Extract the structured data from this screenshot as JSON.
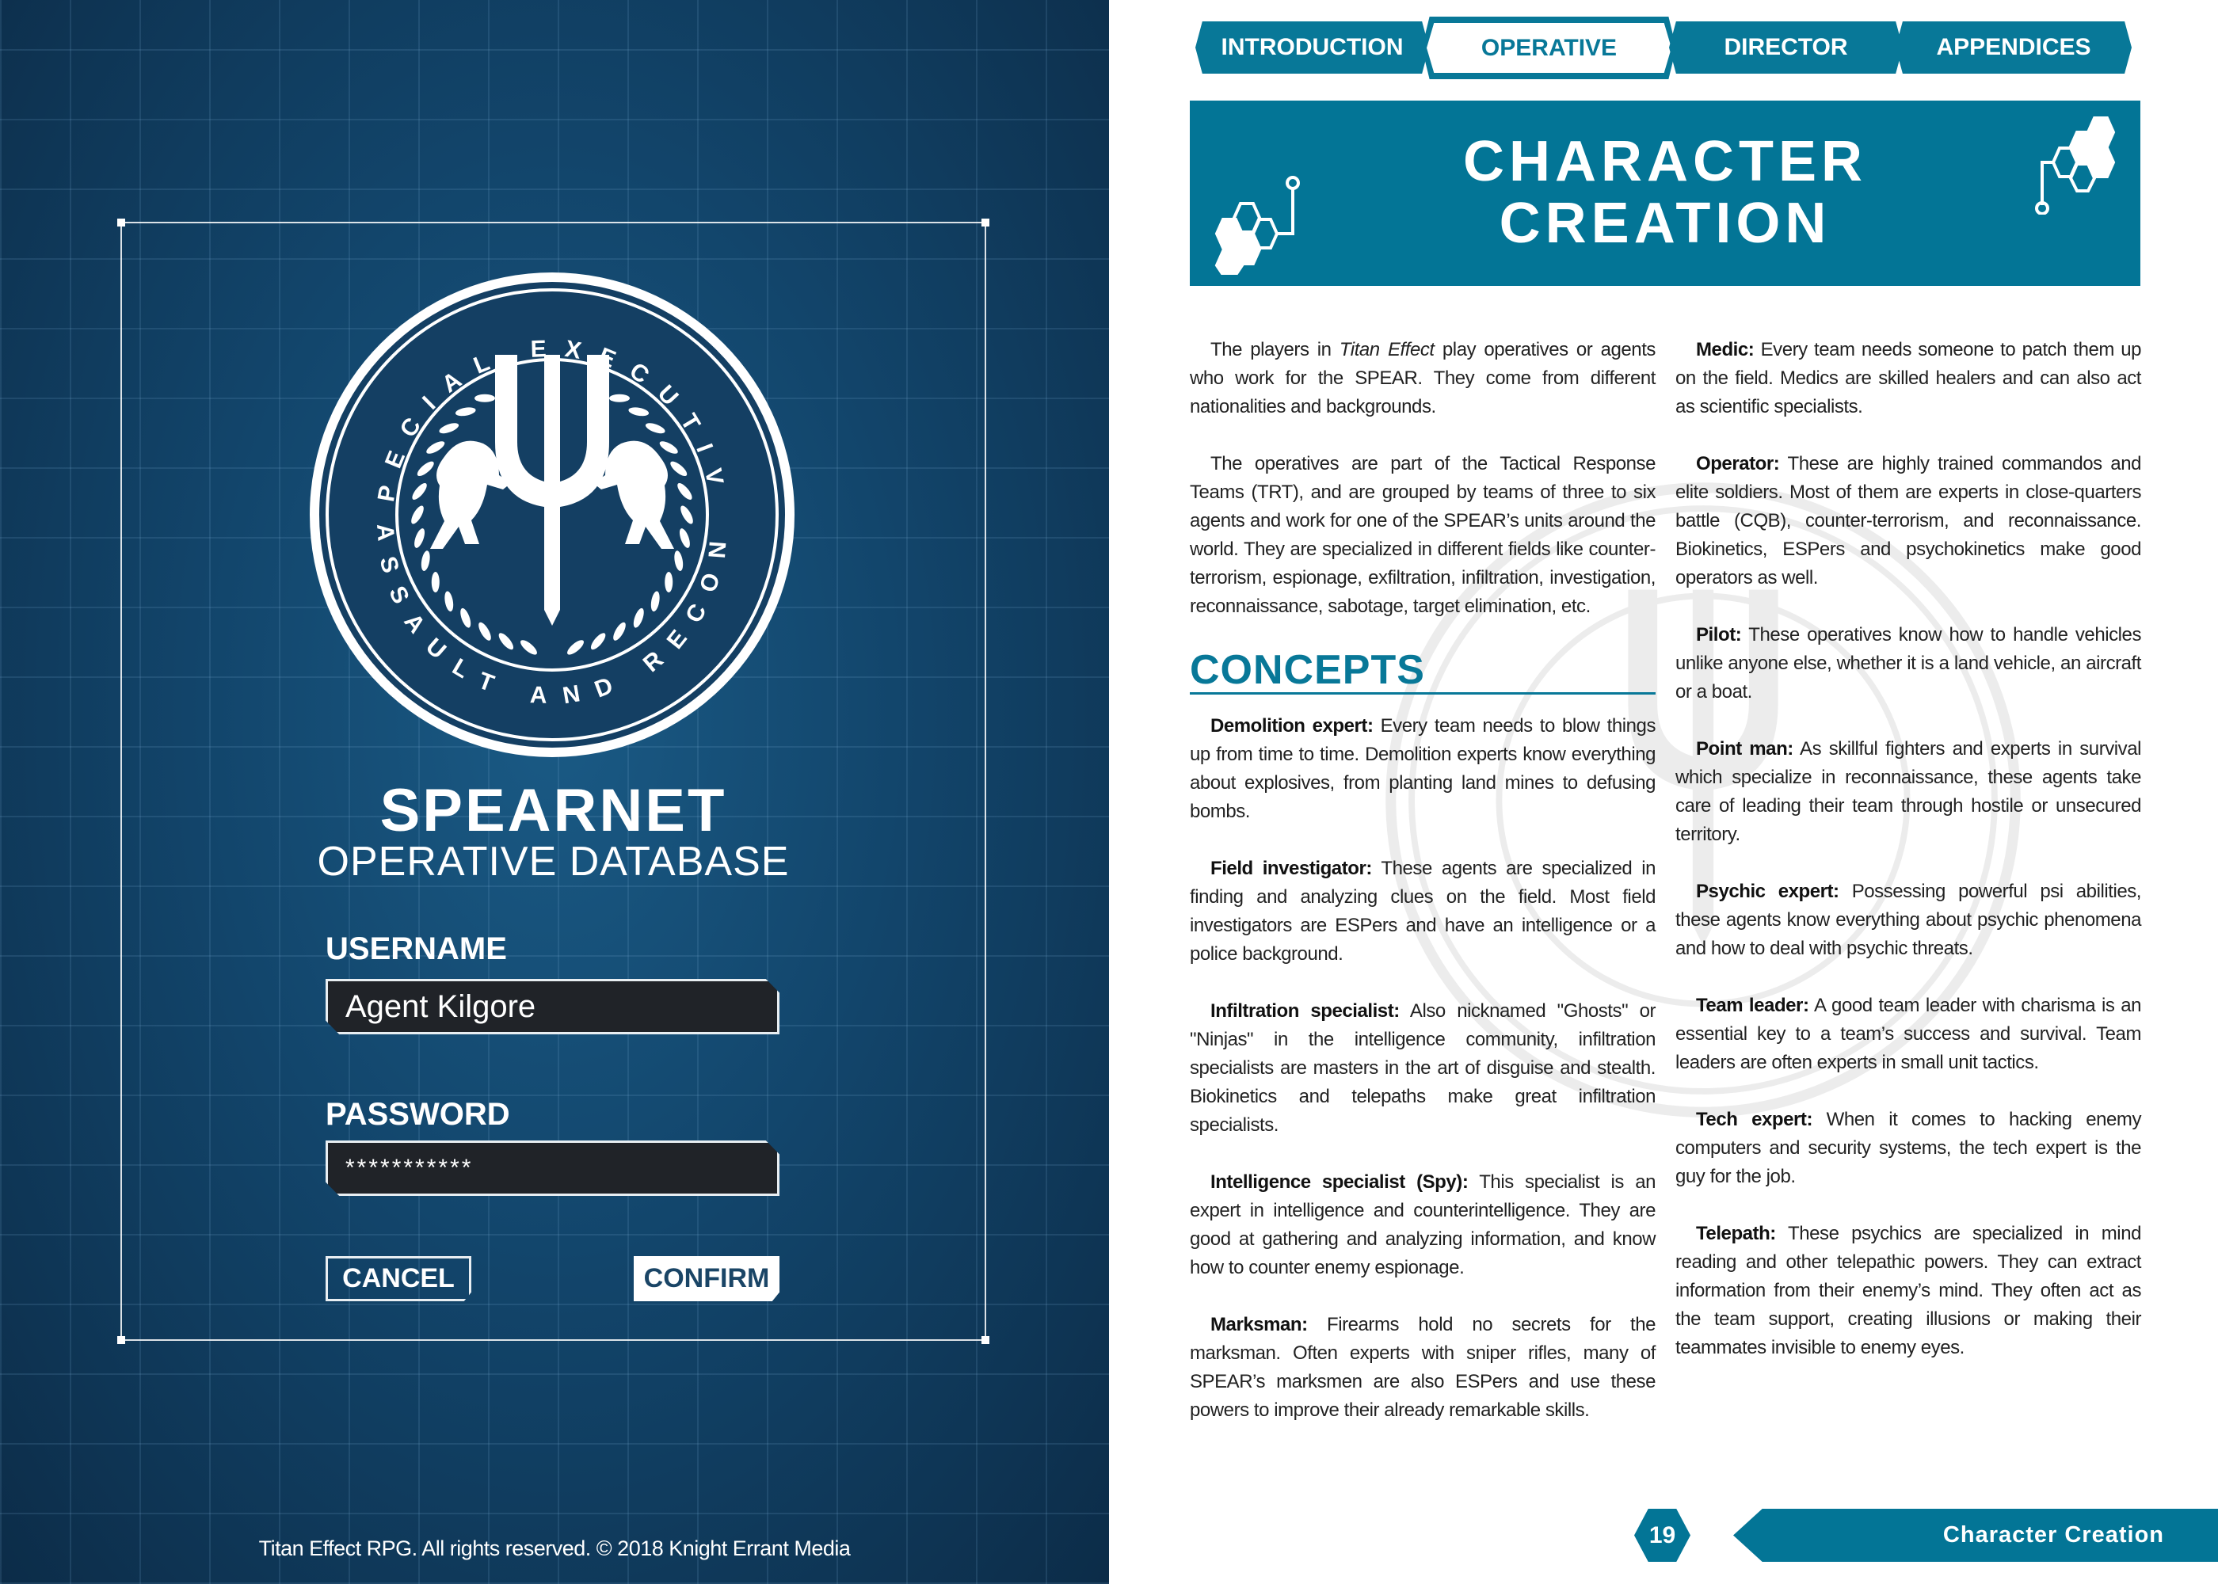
{
  "login": {
    "emblem_top_text": "SPECIAL EXECUTIVE",
    "emblem_bottom_text": "ASSAULT AND RECON",
    "title": "SPEARNET",
    "subtitle": "OPERATIVE DATABASE",
    "username_label": "USERNAME",
    "username_value": "Agent Kilgore",
    "password_label": "PASSWORD",
    "password_value": "***********",
    "cancel_label": "CANCEL",
    "confirm_label": "CONFIRM",
    "copyright": "Titan Effect RPG. All rights reserved. © 2018 Knight Errant Media"
  },
  "nav": {
    "tabs": [
      {
        "label": "INTRODUCTION",
        "active": false
      },
      {
        "label": "OPERATIVE",
        "active": true
      },
      {
        "label": "DIRECTOR",
        "active": false
      },
      {
        "label": "APPENDICES",
        "active": false
      }
    ]
  },
  "banner": {
    "title_line1": "CHARACTER",
    "title_line2": "CREATION"
  },
  "intro": {
    "p1_before": "The players in ",
    "p1_italic": "Titan Effect",
    "p1_after": " play operatives or agents who work for the SPEAR. They come from different nationalities and backgrounds.",
    "p2": "The operatives are part of the Tactical Response Teams (TRT), and are grouped by teams of three to six agents and work for one of the SPEAR’s units around the world. They are specialized in different fields like counter-terrorism, espionage, exfiltration, infiltration, investigation, reconnaissance, sabotage, target elimination, etc."
  },
  "concepts_heading": "CONCEPTS",
  "concepts_left": [
    {
      "term": "Demolition expert:",
      "text": " Every team needs to blow things up from time to time. Demolition experts know everything about explosives, from planting land mines to defusing bombs."
    },
    {
      "term": "Field investigator:",
      "text": " These agents are specialized in finding and analyzing clues on the field. Most field investigators are ESPers and have an intelligence or a police background."
    },
    {
      "term": "Infiltration specialist:",
      "text": " Also nicknamed \"Ghosts\" or \"Ninjas\" in the intelligence community, infiltration specialists are masters in the art of disguise and stealth. Biokinetics and telepaths make great infiltration specialists."
    },
    {
      "term": "Intelligence specialist (Spy):",
      "text": " This specialist is an expert in intelligence and counterintelligence. They are good at gathering and analyzing information, and know how to counter enemy espionage."
    },
    {
      "term": "Marksman:",
      "text": " Firearms hold no secrets for the marksman. Often experts with sniper rifles, many of SPEAR’s marksmen are also ESPers and use these powers to improve their already remarkable skills."
    }
  ],
  "concepts_right": [
    {
      "term": "Medic:",
      "text": " Every team needs someone to patch them up on the field. Medics are skilled healers and can also act as scientific specialists."
    },
    {
      "term": "Operator:",
      "text": " These are highly trained commandos and elite soldiers. Most of them are experts in close-quarters battle (CQB), counter-terrorism, and reconnaissance. Biokinetics, ESPers and psychokinetics make good operators as well."
    },
    {
      "term": "Pilot:",
      "text": " These operatives know how to handle vehicles unlike anyone else, whether it is a land vehicle, an aircraft or a boat."
    },
    {
      "term": "Point man:",
      "text": " As skillful fighters and experts in survival which specialize in reconnaissance, these agents take care of leading their team through hostile or unsecured territory."
    },
    {
      "term": "Psychic expert:",
      "text": " Possessing powerful psi abilities, these agents know everything about psychic phenomena and how to deal with psychic threats."
    },
    {
      "term": "Team leader:",
      "text": " A good team leader with charisma is an essential key to a team’s success and survival. Team leaders are often experts in small unit tactics."
    },
    {
      "term": "Tech expert:",
      "text": " When it comes to hacking enemy computers and security systems, the tech expert is the guy for the job."
    },
    {
      "term": "Telepath:",
      "text": " These psychics are specialized in mind reading and other telepathic powers. They can extract information from their enemy’s mind. They often act as the team support, creating illusions or making their teammates invisible to enemy eyes."
    }
  ],
  "footer": {
    "page_number": "19",
    "section": "Character Creation"
  },
  "colors": {
    "accent": "#037596",
    "panel_dark": "#0c2c48",
    "input_bg": "#202328"
  }
}
